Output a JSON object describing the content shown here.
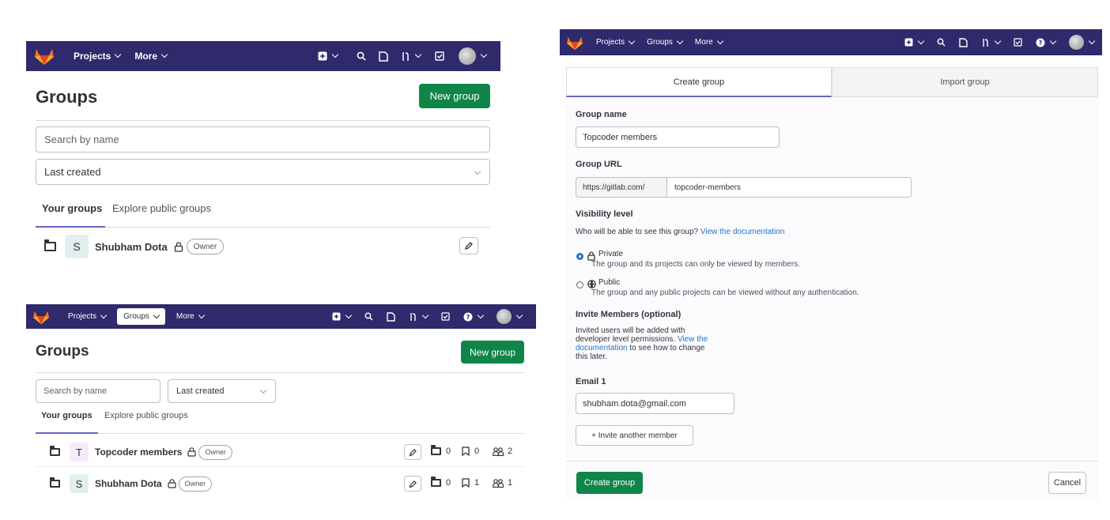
{
  "nav": {
    "projects": "Projects",
    "groups": "Groups",
    "more": "More"
  },
  "groups_page": {
    "title": "Groups",
    "new_group": "New group",
    "search_placeholder": "Search by name",
    "sort_selected": "Last created",
    "tab_your_groups": "Your groups",
    "tab_explore": "Explore public groups"
  },
  "groups_panel_1": {
    "rows": [
      {
        "initial": "S",
        "name": "Shubham Dota",
        "role": "Owner"
      }
    ]
  },
  "groups_panel_2": {
    "rows": [
      {
        "initial": "T",
        "name": "Topcoder members",
        "role": "Owner",
        "subgroups": "0",
        "projects": "0",
        "members": "2"
      },
      {
        "initial": "S",
        "name": "Shubham Dota",
        "role": "Owner",
        "subgroups": "0",
        "projects": "1",
        "members": "1"
      }
    ]
  },
  "create_form": {
    "tab_create": "Create group",
    "tab_import": "Import group",
    "group_name_label": "Group name",
    "group_name_value": "Topcoder members",
    "group_url_label": "Group URL",
    "url_prefix": "https://gitlab.com/",
    "url_value": "topcoder-members",
    "visibility_label": "Visibility level",
    "visibility_help": "Who will be able to see this group?",
    "visibility_help_link": "View the documentation",
    "private_label": "Private",
    "private_desc": "The group and its projects can only be viewed by members.",
    "public_label": "Public",
    "public_desc": "The group and any public projects can be viewed without any authentication.",
    "invite_label": "Invite Members (optional)",
    "invite_line1": "Invited users will be added with",
    "invite_line2_a": "developer level permissions.",
    "invite_line2_link": "View the",
    "invite_line3_link": "documentation",
    "invite_line3_b": "to see how to change",
    "invite_line4": "this later.",
    "email_label": "Email 1",
    "email_value": "shubham.dota@gmail.com",
    "invite_another": "+ Invite another member",
    "create_btn": "Create group",
    "cancel_btn": "Cancel"
  },
  "colors": {
    "navbar": "#2f2a6b",
    "primary_button": "#108548",
    "link": "#1f75cb",
    "tab_underline": "#6666c4"
  }
}
